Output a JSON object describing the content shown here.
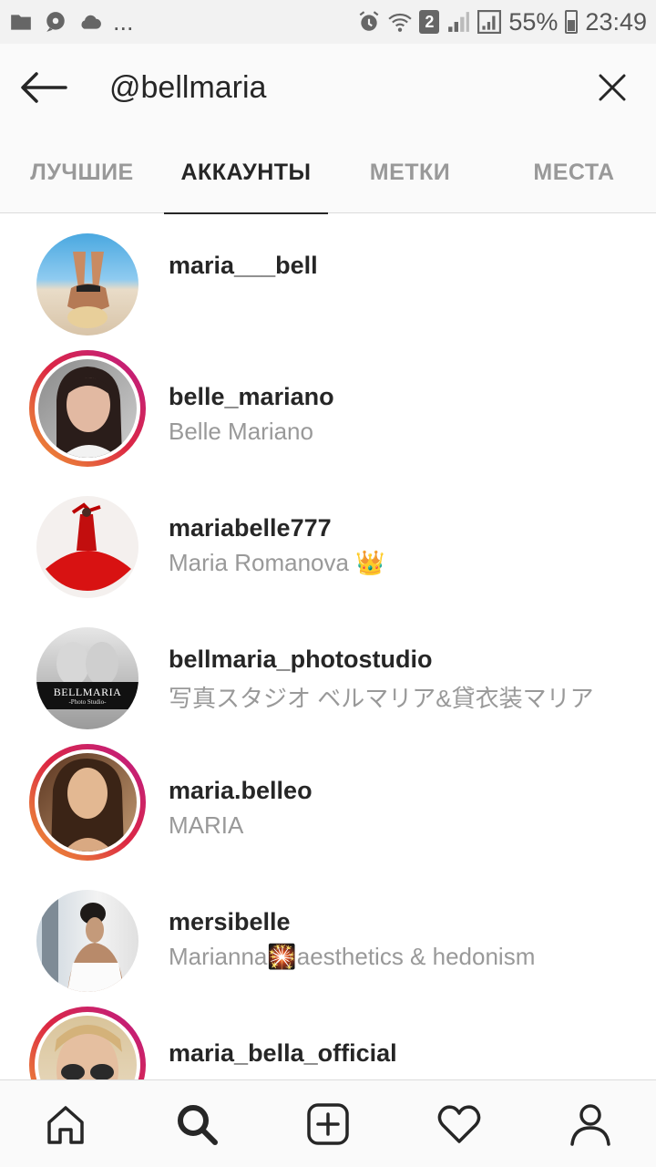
{
  "status_bar": {
    "left_icons": [
      "folder-icon",
      "chat-icon",
      "cloud-icon"
    ],
    "overflow": "...",
    "sim": "2",
    "battery": "55%",
    "time": "23:49"
  },
  "search": {
    "query": "@bellmaria"
  },
  "tabs": [
    {
      "label": "ЛУЧШИЕ",
      "active": false
    },
    {
      "label": "АККАУНТЫ",
      "active": true
    },
    {
      "label": "МЕТКИ",
      "active": false
    },
    {
      "label": "МЕСТА",
      "active": false
    }
  ],
  "results": [
    {
      "username": "maria___bell",
      "full_name": "",
      "story": false
    },
    {
      "username": "belle_mariano",
      "full_name": "Belle Mariano",
      "story": true
    },
    {
      "username": "mariabelle777",
      "full_name": "Maria Romanova 👑",
      "story": false
    },
    {
      "username": "bellmaria_photostudio",
      "full_name": "写真スタジオ ベルマリア&貸衣装マリア",
      "story": false,
      "logo_text": "BELLMARIA",
      "logo_sub": "-Photo Studio-"
    },
    {
      "username": "maria.belleo",
      "full_name": "MARIA",
      "story": true
    },
    {
      "username": "mersibelle",
      "full_name": "Marianna🎇aesthetics & hedonism",
      "story": false
    },
    {
      "username": "maria_bella_official",
      "full_name": "",
      "story": true
    }
  ],
  "bottom_nav": [
    "home-icon",
    "search-icon",
    "add-icon",
    "heart-icon",
    "profile-icon"
  ],
  "colors": {
    "story_gradient_start": "#f09433",
    "story_gradient_end": "#bc1888",
    "secondary_text": "#999999",
    "primary_text": "#262626"
  }
}
